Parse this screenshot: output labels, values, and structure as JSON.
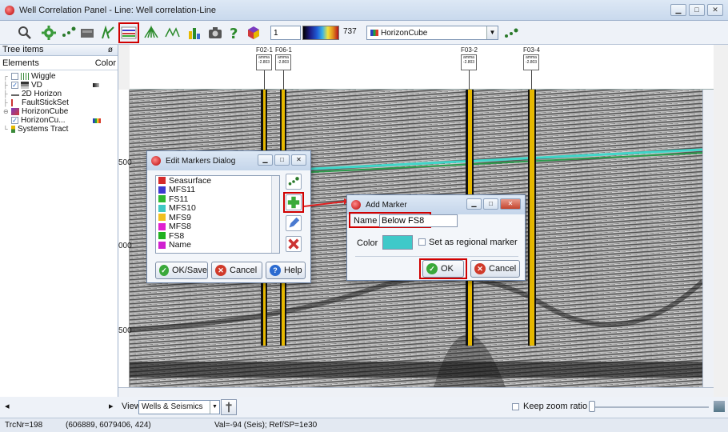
{
  "window": {
    "title": "Well Correlation Panel - Line: Well correlation-Line",
    "buttons": [
      "minimize",
      "maximize",
      "close"
    ]
  },
  "toolbar": {
    "icons": [
      "zoom-icon",
      "settings-icon",
      "wells-icon",
      "seismic-icon",
      "display-icon",
      "markers-icon",
      "horizon-fan-icon",
      "horizon-pick-icon",
      "chart-icon",
      "camera-icon",
      "help-icon",
      "cube-icon",
      "more-icon"
    ],
    "min_value": "1",
    "max_value": "737",
    "selection": "HorizonCube",
    "colors": {
      "highlight": "#d00000"
    }
  },
  "tree": {
    "title": "Tree items",
    "col_elements": "Elements",
    "col_color": "Color",
    "items": [
      {
        "label": "Wiggle",
        "checked": false
      },
      {
        "label": "VD",
        "checked": true
      },
      {
        "label": "2D Horizon"
      },
      {
        "label": "FaultStickSet"
      },
      {
        "label": "HorizonCube"
      },
      {
        "label": "HorizonCu...",
        "checked": true
      },
      {
        "label": "Systems Tract"
      }
    ]
  },
  "wells": [
    {
      "name": "F02-1",
      "box": "amma\n-2.803"
    },
    {
      "name": "F06-1",
      "box": "amma\n-2.803"
    },
    {
      "name": "F03-2",
      "box": "amma\n-2.803"
    },
    {
      "name": "F03-4",
      "box": "amma\n-2.803"
    }
  ],
  "depths": [
    "500",
    "000",
    "500"
  ],
  "edit_markers_dialog": {
    "title": "Edit Markers Dialog",
    "markers": [
      {
        "name": "Seasurface",
        "color": "#d42a2a"
      },
      {
        "name": "MFS11",
        "color": "#3d3ad0"
      },
      {
        "name": "FS11",
        "color": "#2fb82f"
      },
      {
        "name": "MFS10",
        "color": "#3fc9c4"
      },
      {
        "name": "MFS9",
        "color": "#f0c020"
      },
      {
        "name": "MFS8",
        "color": "#e020d0"
      },
      {
        "name": "FS8",
        "color": "#20b020"
      },
      {
        "name": "Name",
        "color": "#d020d0"
      }
    ],
    "ok_label": "OK/Save",
    "cancel_label": "Cancel",
    "help_label": "Help"
  },
  "add_marker_dialog": {
    "title": "Add Marker",
    "name_label": "Name",
    "name_value": "Below FS8",
    "color_label": "Color",
    "color_value": "#3fc9c9",
    "regional_label": "Set as regional marker",
    "ok_label": "OK",
    "cancel_label": "Cancel"
  },
  "bottom": {
    "view_label": "View",
    "view_value": "Wells & Seismics",
    "keep_zoom_label": "Keep zoom ratio"
  },
  "status": {
    "trcnr": "TrcNr=198",
    "coords": "(606889, 6079406, 424)",
    "val": "Val=-94 (Seis); Ref/SP=1e30"
  }
}
